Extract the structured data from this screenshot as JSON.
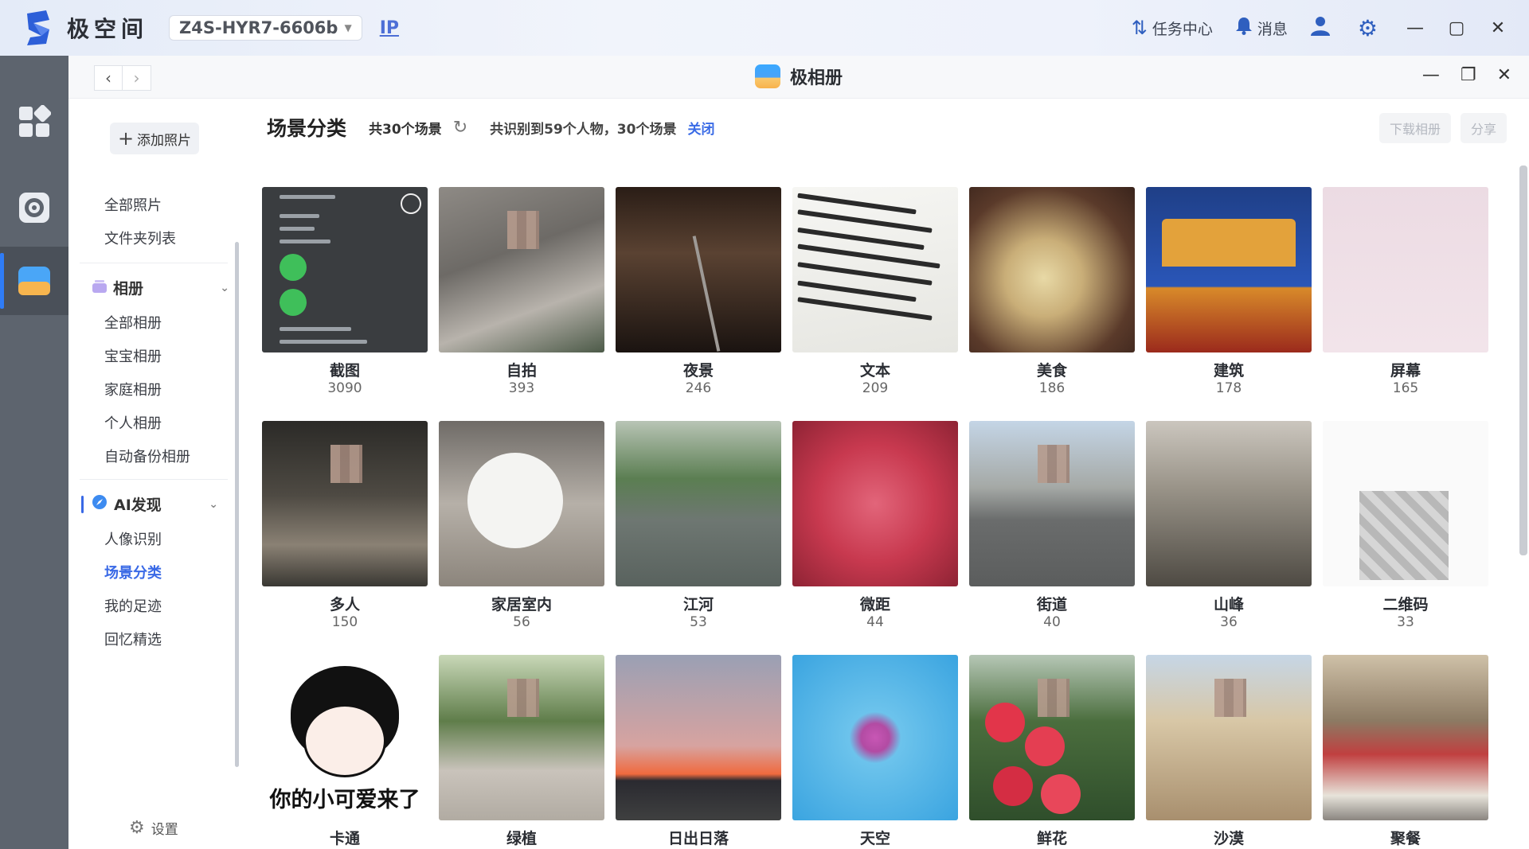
{
  "topbar": {
    "brand_name": "极空间",
    "device_name": "Z4S-HYR7-6606b",
    "ip_label": "IP",
    "task_center": "任务中心",
    "messages": "消息"
  },
  "window": {
    "title": "极相册"
  },
  "sidebar": {
    "add_photo": "添加照片",
    "all_photos": "全部照片",
    "folder_list": "文件夹列表",
    "albums_section": "相册",
    "albums": [
      "全部相册",
      "宝宝相册",
      "家庭相册",
      "个人相册",
      "自动备份相册"
    ],
    "ai_section": "AI发现",
    "ai_items": [
      "人像识别",
      "场景分类",
      "我的足迹",
      "回忆精选"
    ],
    "ai_active_index": 1,
    "settings": "设置"
  },
  "header": {
    "title": "场景分类",
    "count_text": "共30个场景",
    "info_text": "共识别到59个人物，30个场景",
    "close_label": "关闭",
    "download_label": "下载相册",
    "share_label": "分享"
  },
  "scenes": [
    {
      "name": "截图",
      "count": "3090",
      "art": "t-screenshot"
    },
    {
      "name": "自拍",
      "count": "393",
      "art": "t-selfie"
    },
    {
      "name": "夜景",
      "count": "246",
      "art": "t-night"
    },
    {
      "name": "文本",
      "count": "209",
      "art": "t-text"
    },
    {
      "name": "美食",
      "count": "186",
      "art": "t-food"
    },
    {
      "name": "建筑",
      "count": "178",
      "art": "t-building"
    },
    {
      "name": "屏幕",
      "count": "165",
      "art": "t-screen"
    },
    {
      "name": "多人",
      "count": "150",
      "art": "t-crowd"
    },
    {
      "name": "家居室内",
      "count": "56",
      "art": "t-home"
    },
    {
      "name": "江河",
      "count": "53",
      "art": "t-river"
    },
    {
      "name": "微距",
      "count": "44",
      "art": "t-macro"
    },
    {
      "name": "街道",
      "count": "40",
      "art": "t-street"
    },
    {
      "name": "山峰",
      "count": "36",
      "art": "t-mountain"
    },
    {
      "name": "二维码",
      "count": "33",
      "art": "t-qr"
    },
    {
      "name": "卡通",
      "count": "",
      "art": "t-cartoon",
      "caption": "你的小可爱来了"
    },
    {
      "name": "绿植",
      "count": "",
      "art": "t-green"
    },
    {
      "name": "日出日落",
      "count": "",
      "art": "t-sunset"
    },
    {
      "name": "天空",
      "count": "",
      "art": "t-sky"
    },
    {
      "name": "鲜花",
      "count": "",
      "art": "t-flower"
    },
    {
      "name": "沙漠",
      "count": "",
      "art": "t-desert"
    },
    {
      "name": "聚餐",
      "count": "",
      "art": "t-dinner"
    }
  ],
  "colors": {
    "accent": "#3969e6",
    "dock": "#5d646e",
    "dock_active_bar": "#2f7cf6"
  }
}
